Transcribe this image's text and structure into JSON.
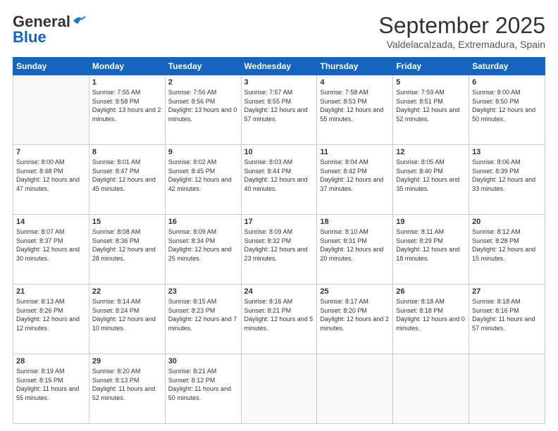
{
  "logo": {
    "line1a": "General",
    "line1b": "Blue"
  },
  "title": "September 2025",
  "subtitle": "Valdelacalzada, Extremadura, Spain",
  "headers": [
    "Sunday",
    "Monday",
    "Tuesday",
    "Wednesday",
    "Thursday",
    "Friday",
    "Saturday"
  ],
  "weeks": [
    [
      {
        "day": "",
        "sunrise": "",
        "sunset": "",
        "daylight": ""
      },
      {
        "day": "1",
        "sunrise": "Sunrise: 7:55 AM",
        "sunset": "Sunset: 8:58 PM",
        "daylight": "Daylight: 13 hours and 2 minutes."
      },
      {
        "day": "2",
        "sunrise": "Sunrise: 7:56 AM",
        "sunset": "Sunset: 8:56 PM",
        "daylight": "Daylight: 13 hours and 0 minutes."
      },
      {
        "day": "3",
        "sunrise": "Sunrise: 7:57 AM",
        "sunset": "Sunset: 8:55 PM",
        "daylight": "Daylight: 12 hours and 57 minutes."
      },
      {
        "day": "4",
        "sunrise": "Sunrise: 7:58 AM",
        "sunset": "Sunset: 8:53 PM",
        "daylight": "Daylight: 12 hours and 55 minutes."
      },
      {
        "day": "5",
        "sunrise": "Sunrise: 7:59 AM",
        "sunset": "Sunset: 8:51 PM",
        "daylight": "Daylight: 12 hours and 52 minutes."
      },
      {
        "day": "6",
        "sunrise": "Sunrise: 8:00 AM",
        "sunset": "Sunset: 8:50 PM",
        "daylight": "Daylight: 12 hours and 50 minutes."
      }
    ],
    [
      {
        "day": "7",
        "sunrise": "Sunrise: 8:00 AM",
        "sunset": "Sunset: 8:48 PM",
        "daylight": "Daylight: 12 hours and 47 minutes."
      },
      {
        "day": "8",
        "sunrise": "Sunrise: 8:01 AM",
        "sunset": "Sunset: 8:47 PM",
        "daylight": "Daylight: 12 hours and 45 minutes."
      },
      {
        "day": "9",
        "sunrise": "Sunrise: 8:02 AM",
        "sunset": "Sunset: 8:45 PM",
        "daylight": "Daylight: 12 hours and 42 minutes."
      },
      {
        "day": "10",
        "sunrise": "Sunrise: 8:03 AM",
        "sunset": "Sunset: 8:44 PM",
        "daylight": "Daylight: 12 hours and 40 minutes."
      },
      {
        "day": "11",
        "sunrise": "Sunrise: 8:04 AM",
        "sunset": "Sunset: 8:42 PM",
        "daylight": "Daylight: 12 hours and 37 minutes."
      },
      {
        "day": "12",
        "sunrise": "Sunrise: 8:05 AM",
        "sunset": "Sunset: 8:40 PM",
        "daylight": "Daylight: 12 hours and 35 minutes."
      },
      {
        "day": "13",
        "sunrise": "Sunrise: 8:06 AM",
        "sunset": "Sunset: 8:39 PM",
        "daylight": "Daylight: 12 hours and 33 minutes."
      }
    ],
    [
      {
        "day": "14",
        "sunrise": "Sunrise: 8:07 AM",
        "sunset": "Sunset: 8:37 PM",
        "daylight": "Daylight: 12 hours and 30 minutes."
      },
      {
        "day": "15",
        "sunrise": "Sunrise: 8:08 AM",
        "sunset": "Sunset: 8:36 PM",
        "daylight": "Daylight: 12 hours and 28 minutes."
      },
      {
        "day": "16",
        "sunrise": "Sunrise: 8:09 AM",
        "sunset": "Sunset: 8:34 PM",
        "daylight": "Daylight: 12 hours and 25 minutes."
      },
      {
        "day": "17",
        "sunrise": "Sunrise: 8:09 AM",
        "sunset": "Sunset: 8:32 PM",
        "daylight": "Daylight: 12 hours and 23 minutes."
      },
      {
        "day": "18",
        "sunrise": "Sunrise: 8:10 AM",
        "sunset": "Sunset: 8:31 PM",
        "daylight": "Daylight: 12 hours and 20 minutes."
      },
      {
        "day": "19",
        "sunrise": "Sunrise: 8:11 AM",
        "sunset": "Sunset: 8:29 PM",
        "daylight": "Daylight: 12 hours and 18 minutes."
      },
      {
        "day": "20",
        "sunrise": "Sunrise: 8:12 AM",
        "sunset": "Sunset: 8:28 PM",
        "daylight": "Daylight: 12 hours and 15 minutes."
      }
    ],
    [
      {
        "day": "21",
        "sunrise": "Sunrise: 8:13 AM",
        "sunset": "Sunset: 8:26 PM",
        "daylight": "Daylight: 12 hours and 12 minutes."
      },
      {
        "day": "22",
        "sunrise": "Sunrise: 8:14 AM",
        "sunset": "Sunset: 8:24 PM",
        "daylight": "Daylight: 12 hours and 10 minutes."
      },
      {
        "day": "23",
        "sunrise": "Sunrise: 8:15 AM",
        "sunset": "Sunset: 8:23 PM",
        "daylight": "Daylight: 12 hours and 7 minutes."
      },
      {
        "day": "24",
        "sunrise": "Sunrise: 8:16 AM",
        "sunset": "Sunset: 8:21 PM",
        "daylight": "Daylight: 12 hours and 5 minutes."
      },
      {
        "day": "25",
        "sunrise": "Sunrise: 8:17 AM",
        "sunset": "Sunset: 8:20 PM",
        "daylight": "Daylight: 12 hours and 2 minutes."
      },
      {
        "day": "26",
        "sunrise": "Sunrise: 8:18 AM",
        "sunset": "Sunset: 8:18 PM",
        "daylight": "Daylight: 12 hours and 0 minutes."
      },
      {
        "day": "27",
        "sunrise": "Sunrise: 8:18 AM",
        "sunset": "Sunset: 8:16 PM",
        "daylight": "Daylight: 11 hours and 57 minutes."
      }
    ],
    [
      {
        "day": "28",
        "sunrise": "Sunrise: 8:19 AM",
        "sunset": "Sunset: 8:15 PM",
        "daylight": "Daylight: 11 hours and 55 minutes."
      },
      {
        "day": "29",
        "sunrise": "Sunrise: 8:20 AM",
        "sunset": "Sunset: 8:13 PM",
        "daylight": "Daylight: 11 hours and 52 minutes."
      },
      {
        "day": "30",
        "sunrise": "Sunrise: 8:21 AM",
        "sunset": "Sunset: 8:12 PM",
        "daylight": "Daylight: 11 hours and 50 minutes."
      },
      {
        "day": "",
        "sunrise": "",
        "sunset": "",
        "daylight": ""
      },
      {
        "day": "",
        "sunrise": "",
        "sunset": "",
        "daylight": ""
      },
      {
        "day": "",
        "sunrise": "",
        "sunset": "",
        "daylight": ""
      },
      {
        "day": "",
        "sunrise": "",
        "sunset": "",
        "daylight": ""
      }
    ]
  ]
}
